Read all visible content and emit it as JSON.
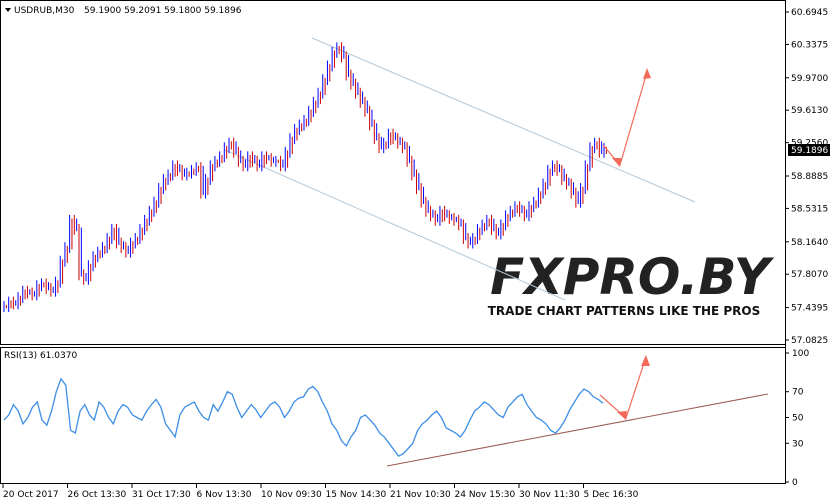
{
  "header": {
    "symbol": "USDRUB,M30",
    "ohlc": "59.1900 59.2091 59.1800 59.1896"
  },
  "rsi_header": "RSI(13) 61.0370",
  "current_price_tag": "59.1896",
  "watermark": {
    "brand": "FXPRO.BY",
    "tagline": "TRADE CHART PATTERNS LIKE THE PROS"
  },
  "colors": {
    "bull": "#0000ff",
    "bear": "#cc0000",
    "rsi_line": "#3c8ee6",
    "channel": "#b3c8d8",
    "arrow": "#f26a5a",
    "trendline": "#9a5a50"
  },
  "chart_data": [
    {
      "type": "line",
      "title": "USDRUB,M30",
      "y_ticks": [
        "60.6945",
        "60.3375",
        "59.9700",
        "59.6130",
        "59.2560",
        "58.8885",
        "58.5315",
        "58.1640",
        "57.8070",
        "57.4395",
        "57.0825"
      ],
      "ylim": [
        57.0825,
        60.6945
      ],
      "x_ticks": [
        "20 Oct 2017",
        "26 Oct 13:30",
        "31 Oct 17:30",
        "6 Nov 13:30",
        "10 Nov 09:30",
        "15 Nov 14:30",
        "21 Nov 10:30",
        "24 Nov 15:30",
        "30 Nov 11:30",
        "5 Dec 16:30"
      ],
      "series": [
        {
          "values": [
            57.45,
            57.5,
            57.48,
            57.55,
            57.62,
            57.6,
            57.58,
            57.68,
            57.7,
            57.65,
            57.62,
            57.72,
            57.95,
            58.1,
            58.4,
            58.3,
            57.8,
            57.75,
            57.9,
            58.0,
            58.05,
            58.1,
            58.2,
            58.3,
            58.15,
            58.1,
            58.05,
            58.15,
            58.2,
            58.3,
            58.4,
            58.5,
            58.6,
            58.75,
            58.85,
            58.9,
            59.0,
            58.95,
            58.9,
            58.92,
            58.95,
            58.98,
            58.7,
            58.85,
            59.0,
            59.05,
            59.1,
            59.2,
            59.25,
            59.15,
            59.05,
            59.0,
            59.1,
            59.05,
            59.0,
            59.1,
            59.08,
            59.05,
            59.05,
            59.0,
            59.15,
            59.3,
            59.4,
            59.45,
            59.5,
            59.6,
            59.7,
            59.8,
            59.95,
            60.1,
            60.25,
            60.3,
            60.2,
            60.0,
            59.9,
            59.8,
            59.7,
            59.6,
            59.45,
            59.3,
            59.2,
            59.25,
            59.35,
            59.3,
            59.25,
            59.2,
            59.05,
            58.9,
            58.75,
            58.6,
            58.5,
            58.45,
            58.4,
            58.5,
            58.45,
            58.42,
            58.4,
            58.35,
            58.2,
            58.15,
            58.2,
            58.3,
            58.35,
            58.4,
            58.3,
            58.25,
            58.35,
            58.45,
            58.5,
            58.55,
            58.5,
            58.45,
            58.55,
            58.6,
            58.7,
            58.8,
            58.95,
            59.0,
            58.95,
            58.85,
            58.8,
            58.7,
            58.6,
            58.75,
            59.0,
            59.2,
            59.25,
            59.15,
            59.19
          ]
        }
      ]
    },
    {
      "type": "line",
      "title": "RSI(13) 61.0370",
      "y_ticks": [
        "100",
        "70",
        "50",
        "30",
        "0"
      ],
      "ylim": [
        0,
        100
      ],
      "series": [
        {
          "values": [
            48,
            52,
            60,
            55,
            45,
            50,
            58,
            62,
            48,
            44,
            55,
            70,
            80,
            75,
            40,
            38,
            55,
            60,
            52,
            48,
            62,
            58,
            50,
            45,
            55,
            60,
            58,
            52,
            50,
            48,
            55,
            60,
            64,
            58,
            45,
            40,
            35,
            52,
            58,
            60,
            62,
            55,
            50,
            48,
            60,
            55,
            62,
            70,
            68,
            58,
            50,
            55,
            60,
            56,
            50,
            55,
            60,
            62,
            58,
            50,
            55,
            62,
            65,
            66,
            72,
            74,
            70,
            62,
            55,
            45,
            40,
            32,
            28,
            35,
            40,
            50,
            52,
            48,
            44,
            38,
            35,
            30,
            25,
            20,
            22,
            26,
            30,
            40,
            45,
            48,
            52,
            55,
            50,
            42,
            40,
            38,
            35,
            40,
            48,
            55,
            58,
            62,
            60,
            56,
            52,
            50,
            58,
            62,
            66,
            68,
            60,
            55,
            50,
            48,
            45,
            40,
            38,
            42,
            48,
            56,
            62,
            68,
            72,
            70,
            66,
            64,
            61
          ]
        }
      ]
    }
  ]
}
